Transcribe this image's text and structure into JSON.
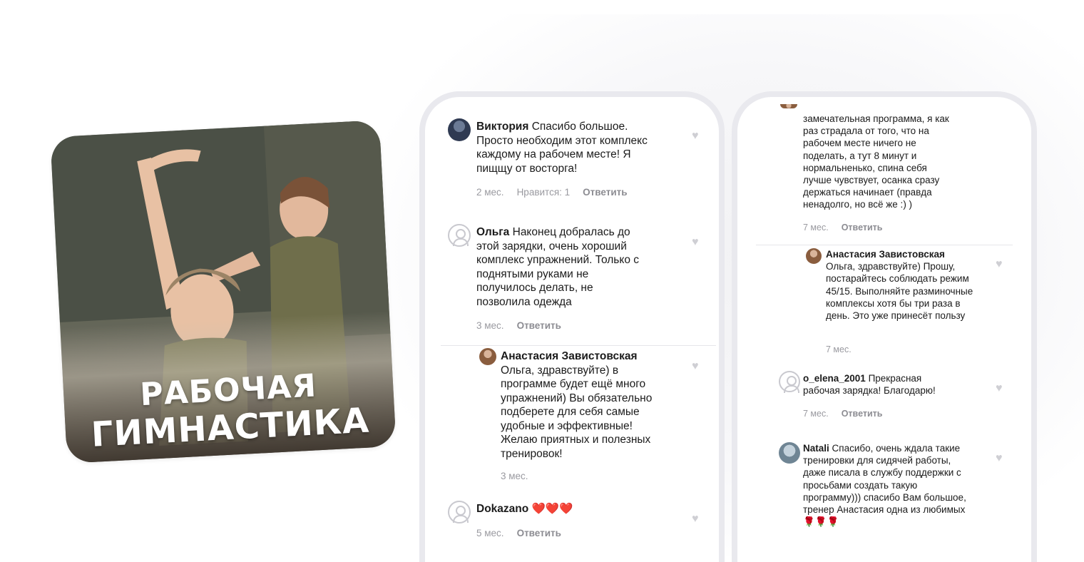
{
  "promo": {
    "title_line1": "РАБОЧАЯ",
    "title_line2": "ГИМНАСТИКА"
  },
  "phone_left": {
    "comments": [
      {
        "author": "Виктория",
        "text": " Спасибо большое. Просто необходим этот комплекс каждому на рабочем месте! Я пищщу от восторга!",
        "time": "2 мес.",
        "likes": "Нравится: 1",
        "reply": "Ответить"
      },
      {
        "author": "Ольга",
        "text": " Наконец добралась до этой зарядки, очень хороший комплекс упражнений. Только с поднятыми руками не получилось делать, не позволила одежда",
        "time": "3 мес.",
        "reply": "Ответить"
      },
      {
        "author": "Анастасия Завистовская",
        "text": "Ольга, здравствуйте) в программе будет ещё много упражнений) Вы обязательно подберете для себя самые удобные и эффективные! Желаю приятных и полезных тренировок!",
        "time": "3 мес."
      },
      {
        "author": "Dokazano",
        "text": " ❤️❤️❤️",
        "time": "5 мес.",
        "reply": "Ответить"
      }
    ]
  },
  "phone_right": {
    "comments": [
      {
        "text": "замечательная программа, я как раз страдала от того, что на рабочем месте ничего не поделать, а тут 8 минут и нормальненько, спина себя лучше чувствует, осанка сразу держаться начинает (правда ненадолго, но всё же :) )",
        "time": "7 мес.",
        "reply": "Ответить"
      },
      {
        "author": "Анастасия Завистовская",
        "text": "Ольга, здравствуйте) Прошу, постарайтесь соблюдать режим 45/15. Выполняйте разминочные комплексы хотя бы три раза в день. Это уже принесёт пользу",
        "time": "7 мес."
      },
      {
        "author": "o_elena_2001",
        "text": " Прекрасная рабочая зарядка! Благодарю!",
        "time": "7 мес.",
        "reply": "Ответить"
      },
      {
        "author": "Natali",
        "text": " Спасибо, очень ждала такие тренировки для сидячей работы, даже писала в службу поддержки с просьбами создать такую программу))) спасибо Вам большое, тренер Анастасия одна из любимых 🌹🌹🌹",
        "time": "",
        "reply": ""
      }
    ]
  }
}
